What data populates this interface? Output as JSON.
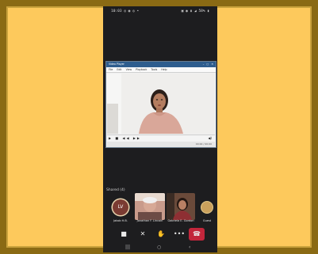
{
  "status_bar": {
    "time": "10:03 ◎ ◉ ◎ •",
    "indicators": "▣ ◉ ▮ ◢ 58% ▮"
  },
  "shared_window": {
    "title": "Video Player",
    "menu": [
      "File",
      "Edit",
      "View",
      "Playback",
      "Tools",
      "Help"
    ],
    "controls_glyphs": "▶ ■ ◀◀ ▶▶",
    "volume_glyph": "◀)",
    "status_left": "",
    "status_right": "00:00 / 00:00"
  },
  "participants_label": "Shared (4)",
  "participants": [
    {
      "initials": "LV",
      "name": "Jakob H.B."
    },
    {
      "name": "Jonathan F. Lincoln"
    },
    {
      "name": "Gabriela E. Gordon"
    },
    {
      "name": "Guest"
    }
  ],
  "call_controls": [
    {
      "icon": "camera-icon",
      "glyph": "■"
    },
    {
      "icon": "mic-off-icon",
      "glyph": "✕"
    },
    {
      "icon": "hand-raise-icon",
      "glyph": "✋"
    },
    {
      "icon": "more-icon",
      "glyph": "•••"
    },
    {
      "icon": "end-call-icon",
      "glyph": "☎"
    }
  ],
  "nav_bar": {
    "recent": "|||",
    "home": "○",
    "back": "‹"
  },
  "colors": {
    "background": "#FDC95C",
    "frame": "#8A6A14",
    "phone": "#1d1d1f",
    "end_call": "#c2263b"
  }
}
